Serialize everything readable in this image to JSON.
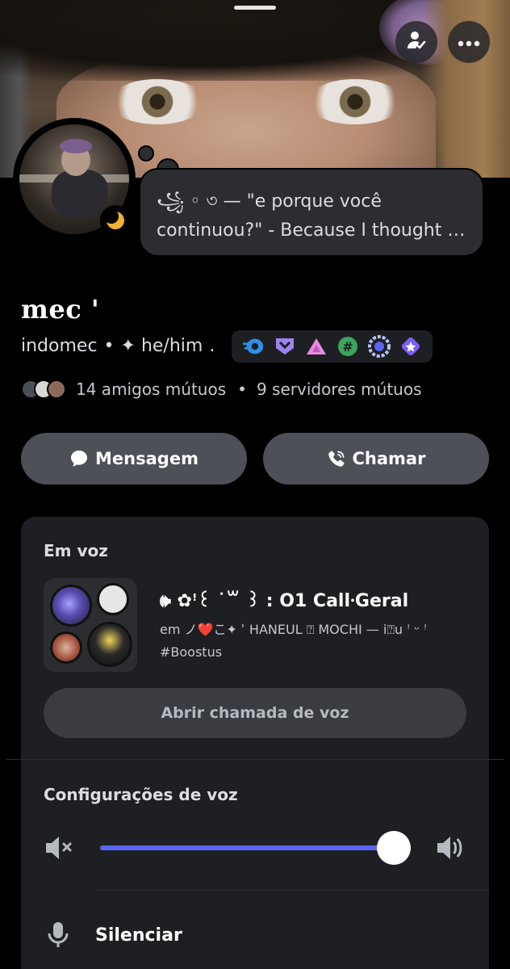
{
  "status": {
    "line1": "꧁ ◦ ৩ — \"e porque você",
    "line2": "continuou?\" - Because I thought s..."
  },
  "profile": {
    "display_name": "mec '",
    "username": "indomec",
    "separator": "•",
    "pronouns": "✦ he/him",
    "pronouns_tail": "."
  },
  "mutuals": {
    "friends": "14 amigos mútuos",
    "dot": "•",
    "servers": "9 servidores mútuos"
  },
  "actions": {
    "message_label": "Mensagem",
    "call_label": "Chamar"
  },
  "voice": {
    "heading": "Em voz",
    "channel_title": "🕪 ✿ꜝ꒰ ˙꒳ ꒱ ꞉ O1  Call⸱Geral",
    "channel_sub": "em ノ❤️こ✦ ʾ HANEUL ⍰ MOCHI — i⍰u ꜝ ᵕ ꜝ #Boostus",
    "open_label": "Abrir chamada de voz"
  },
  "voice_settings": {
    "heading": "Configurações de voz",
    "volume_level": 0.9,
    "mute_label": "Silenciar"
  },
  "colors": {
    "accent": "#5865f2",
    "button_bg": "#4e5058",
    "card_bg": "#1e1f22",
    "status_idle": "#f0b232"
  },
  "icons": {
    "friend": "person-check-icon",
    "more": "ellipsis-icon",
    "message": "chat-bubble-icon",
    "call": "phone-icon",
    "volume_mute": "speaker-mute-icon",
    "volume_up": "speaker-loud-icon",
    "mic": "microphone-icon"
  }
}
